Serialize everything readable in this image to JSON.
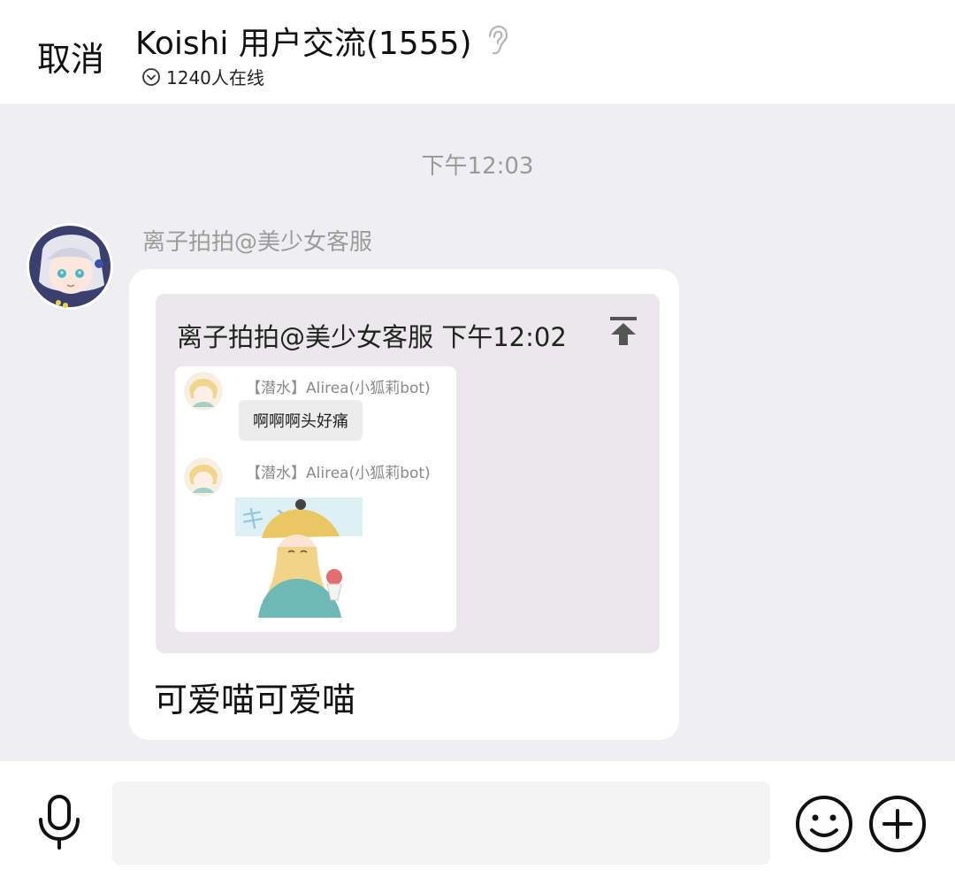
{
  "header": {
    "cancel_label": "取消",
    "title": "Koishi 用户交流(1555)",
    "online_text": "1240人在线"
  },
  "chat": {
    "time_separator": "下午12:03",
    "message": {
      "sender": "离子拍拍@美少女客服",
      "forwarded": {
        "header": "离子拍拍@美少女客服 下午12:02",
        "items": [
          {
            "name": "【潜水】Alirea(小狐莉bot)",
            "text": "啊啊啊头好痛"
          },
          {
            "name": "【潜水】Alirea(小狐莉bot)",
            "sticker_text": "キ  ン"
          }
        ]
      },
      "text": "可爱喵可爱喵"
    }
  },
  "input_bar": {
    "placeholder": "",
    "icons": [
      "microphone-icon",
      "emoji-icon",
      "plus-icon"
    ]
  }
}
